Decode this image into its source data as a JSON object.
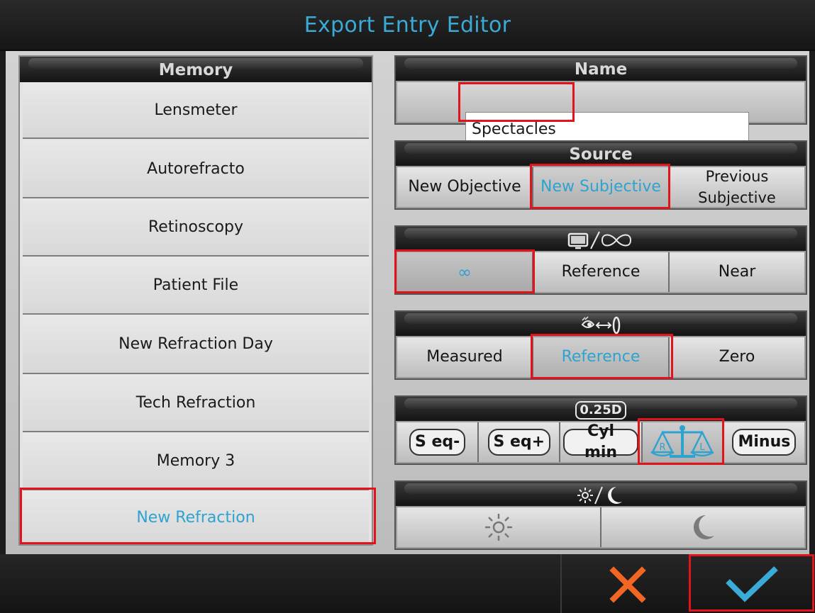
{
  "window": {
    "title": "Export Entry Editor"
  },
  "memory": {
    "header": "Memory",
    "items": [
      {
        "label": "Lensmeter"
      },
      {
        "label": "Autorefracto"
      },
      {
        "label": "Retinoscopy"
      },
      {
        "label": "Patient File"
      },
      {
        "label": "New Refraction Day"
      },
      {
        "label": "Tech Refraction"
      },
      {
        "label": "Memory 3"
      },
      {
        "label": "New Refraction"
      }
    ],
    "selected": "New Refraction"
  },
  "name": {
    "header": "Name",
    "value": "Spectacles"
  },
  "source": {
    "header": "Source",
    "options": [
      "New Objective",
      "New Subjective",
      "Previous Subjective"
    ],
    "selected": "New Subjective"
  },
  "distance": {
    "header_icon": "monitor-slash-infinity-icon",
    "options": [
      "∞",
      "Reference",
      "Near"
    ],
    "selected": "∞"
  },
  "vertex": {
    "header_icon": "eye-to-lens-distance-icon",
    "options": [
      "Measured",
      "Reference",
      "Zero"
    ],
    "selected": "Reference"
  },
  "rounding": {
    "header_label": "0.25D",
    "options": [
      "S eq-",
      "S eq+",
      "Cyl min",
      "balance-R-L-icon",
      "Minus"
    ],
    "balance_labels": [
      "R",
      "L"
    ],
    "selected": "balance-R-L-icon"
  },
  "lighting": {
    "header_icon": "sun-slash-moon-icon",
    "options": [
      "sun-icon",
      "moon-icon"
    ]
  },
  "colors": {
    "accent": "#2ea3cf",
    "highlight": "#e0141a",
    "cancel": "#f26522",
    "ok": "#3aaad6"
  }
}
